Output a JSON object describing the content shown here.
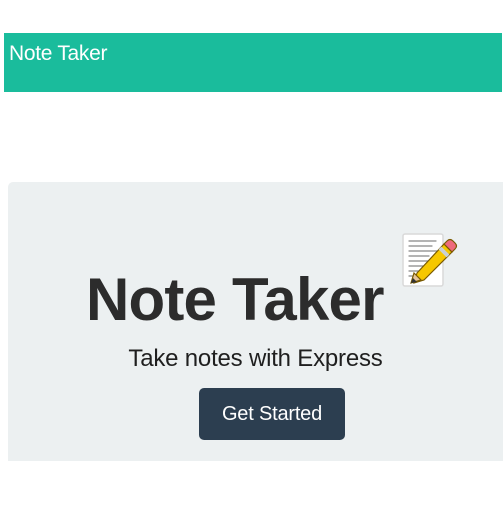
{
  "navbar": {
    "brand": "Note Taker"
  },
  "hero": {
    "title": "Note Taker",
    "icon": "memo-icon",
    "subtitle": "Take notes with Express",
    "button_label": "Get Started"
  },
  "colors": {
    "navbar": "#1abc9c",
    "jumbotron": "#ecf0f1",
    "button": "#2c3e50",
    "text": "#2c2c2c"
  }
}
